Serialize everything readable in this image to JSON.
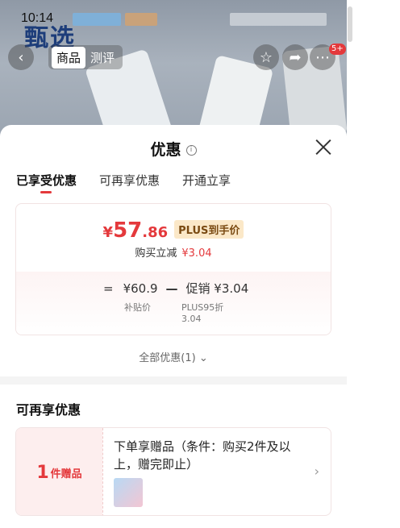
{
  "status": {
    "time": "10:14"
  },
  "background": {
    "brand_text": "甄选"
  },
  "nav": {
    "tab_product": "商品",
    "tab_review": "测评",
    "more_badge": "5+"
  },
  "sheet": {
    "title": "优惠",
    "tabs": [
      {
        "label": "已享受优惠",
        "active": true
      },
      {
        "label": "可再享优惠",
        "active": false
      },
      {
        "label": "开通立享",
        "active": false
      }
    ],
    "price": {
      "currency": "¥",
      "integer": "57",
      "decimal": ".86",
      "tag": "PLUS到手价"
    },
    "reduce": {
      "label": "购买立减",
      "value": "¥3.04"
    },
    "formula": {
      "eq": "=",
      "base": "¥60.9",
      "minus": "—",
      "promo": "促销 ¥3.04",
      "base_label": "补贴价",
      "promo_label_1": "PLUS95折",
      "promo_label_2": "3.04"
    },
    "all_offers": "全部优惠(1)",
    "section_title": "可再享优惠",
    "gift": {
      "count": "1",
      "count_label": "件赠品",
      "description": "下单享赠品（条件：购买2件及以上，赠完即止）"
    }
  },
  "colors": {
    "accent": "#e4393c",
    "plus_tag_bg": "#fbe8c8"
  }
}
